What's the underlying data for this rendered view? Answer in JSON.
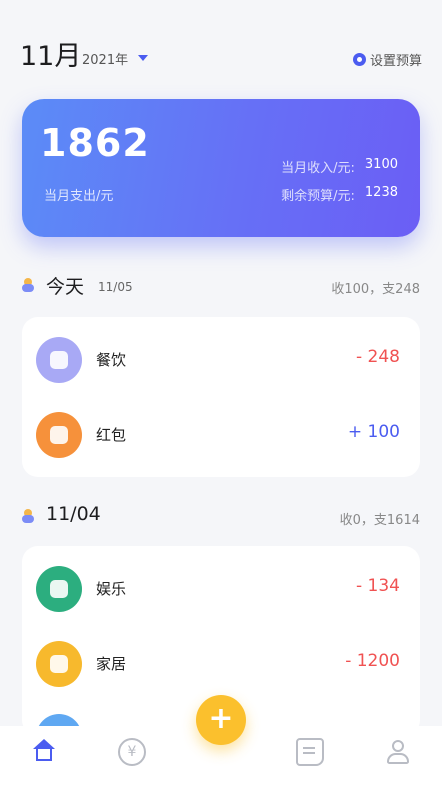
{
  "header": {
    "month": "11月",
    "year": "2021年",
    "settings_label": "设置预算"
  },
  "summary": {
    "spend_value": "1862",
    "spend_label": "当月支出/元",
    "income_label": "当月收入/元:",
    "income_value": "3100",
    "budget_label": "剩余预算/元:",
    "budget_value": "1238"
  },
  "days": [
    {
      "title": "今天",
      "date": "11/05",
      "total": "收100，支248",
      "items": [
        {
          "name": "餐饮",
          "amount": "- 248",
          "color": "#a8a9f5"
        },
        {
          "name": "红包",
          "amount": "+ 100",
          "color": "#f6913b"
        }
      ]
    },
    {
      "title": "11/04",
      "date": "",
      "total": "收0，支1614",
      "items": [
        {
          "name": "娱乐",
          "amount": "- 134",
          "color": "#2cae7f"
        },
        {
          "name": "家居",
          "amount": "- 1200",
          "color": "#f7b92d"
        }
      ]
    }
  ],
  "fab": {
    "label": "+"
  },
  "tabbar": {
    "icons": [
      "home-icon",
      "yen-icon",
      "document-icon",
      "user-icon"
    ],
    "yen_glyph": "¥"
  },
  "colors": {
    "accent": "#4b5cf0",
    "expense": "#f05252",
    "income": "#4b5cf0",
    "fab": "#fbc02d"
  }
}
